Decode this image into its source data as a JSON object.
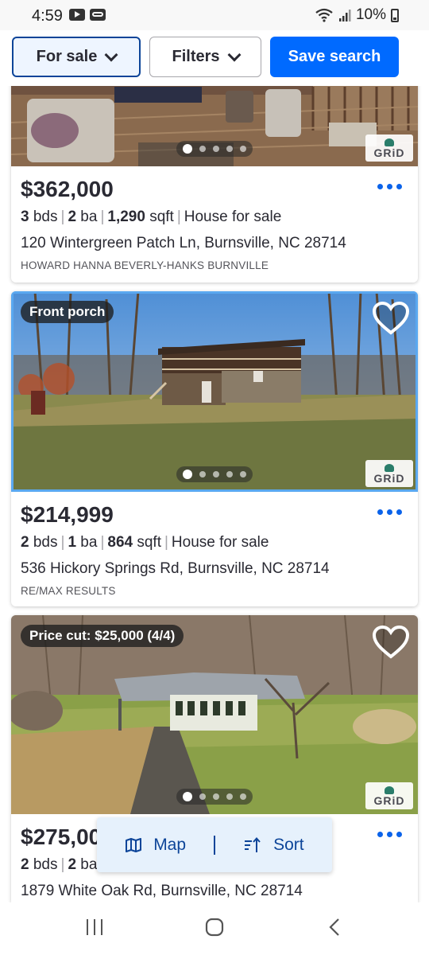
{
  "status_bar": {
    "time": "4:59",
    "battery": "10%"
  },
  "top_bar": {
    "for_sale_label": "For sale",
    "filters_label": "Filters",
    "save_search_label": "Save search"
  },
  "listings": [
    {
      "price": "$362,000",
      "beds": "3",
      "beds_unit": "bds",
      "baths": "2",
      "baths_unit": "ba",
      "sqft": "1,290",
      "sqft_unit": "sqft",
      "type": "House for sale",
      "address": "120 Wintergreen Patch Ln, Burnsville, NC 28714",
      "broker": "HOWARD HANNA BEVERLY-HANKS BURNVILLE",
      "photo_logo": "GRiD"
    },
    {
      "badge": "Front porch",
      "price": "$214,999",
      "beds": "2",
      "beds_unit": "bds",
      "baths": "1",
      "baths_unit": "ba",
      "sqft": "864",
      "sqft_unit": "sqft",
      "type": "House for sale",
      "address": "536 Hickory Springs Rd, Burnsville, NC 28714",
      "broker": "RE/MAX RESULTS",
      "photo_logo": "GRiD"
    },
    {
      "badge": "Price cut: $25,000 (4/4)",
      "price": "$275,00",
      "beds": "2",
      "beds_unit": "bds",
      "baths": "2",
      "baths_unit": "ba",
      "address": "1879 White Oak Rd, Burnsville, NC 28714",
      "photo_logo": "GRiD"
    }
  ],
  "map_sort": {
    "map_label": "Map",
    "sort_label": "Sort"
  },
  "colors": {
    "accent": "#006aff",
    "link": "#0b63ea",
    "text": "#2a2a33"
  },
  "icons": [
    "youtube-icon",
    "voicemail-icon",
    "wifi-icon",
    "signal-icon",
    "battery-icon",
    "chevron-down-icon",
    "heart-icon",
    "more-icon",
    "map-icon",
    "sort-icon",
    "recents-icon",
    "home-icon",
    "back-icon"
  ]
}
